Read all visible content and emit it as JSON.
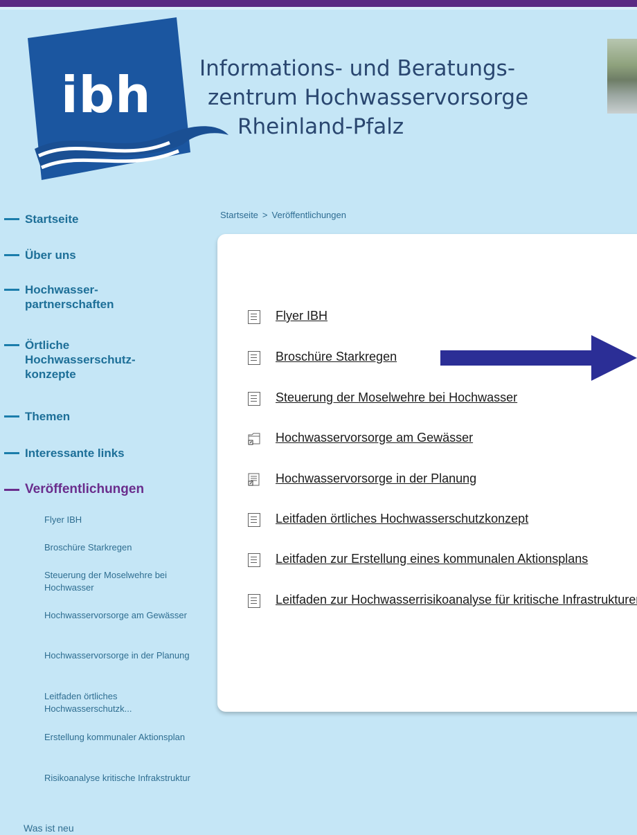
{
  "header": {
    "logo_text": "ibh",
    "org_name_line1": "Informations- und Beratungs-",
    "org_name_line2": "zentrum Hochwasservorsorge",
    "org_name_line3": "Rheinland-Pfalz"
  },
  "breadcrumb": {
    "home": "Startseite",
    "separator": ">",
    "current": "Veröffentlichungen"
  },
  "sidebar": {
    "items": [
      {
        "label": "Startseite"
      },
      {
        "label": "Über uns"
      },
      {
        "label": "Hochwasser-\npartnerschaften"
      },
      {
        "label": "Örtliche\nHochwasserschutz-\nkonzepte"
      },
      {
        "label": "Themen"
      },
      {
        "label": "Interessante links"
      },
      {
        "label": "Veröffentlichungen",
        "active": true
      }
    ],
    "subitems": [
      "Flyer IBH",
      "Broschüre Starkregen",
      "Steuerung der Moselwehre bei Hochwasser",
      "Hochwasservorsorge am Gewässer",
      "Hochwasservorsorge in der Planung",
      "Leitfaden örtliches Hochwasserschutzk...",
      "Erstellung kommunaler Aktionsplan",
      "Risikoanalyse kritische Infrakstruktur"
    ],
    "whats_new": "Was ist neu"
  },
  "documents": [
    {
      "title": "Flyer IBH",
      "icon": "document-icon"
    },
    {
      "title": "Broschüre Starkregen",
      "icon": "document-icon"
    },
    {
      "title": "Steuerung der Moselwehre bei Hochwasser",
      "icon": "document-icon"
    },
    {
      "title": "Hochwasservorsorge am Gewässer",
      "icon": "folder-shortcut-icon"
    },
    {
      "title": "Hochwasservorsorge in der Planung",
      "icon": "document-shortcut-icon"
    },
    {
      "title": "Leitfaden örtliches Hochwasserschutzkonzept",
      "icon": "document-icon"
    },
    {
      "title": "Leitfaden zur Erstellung eines kommunalen Aktionsplans",
      "icon": "document-icon"
    },
    {
      "title": "Leitfaden zur Hochwasserrisikoanalyse für kritische Infrastrukturen",
      "icon": "document-icon"
    }
  ],
  "colors": {
    "background": "#c5e6f6",
    "top_bar": "#5a2a82",
    "nav_text": "#1d6f98",
    "nav_active": "#6a2d8c",
    "logo_blue": "#1b56a0",
    "arrow": "#2b2e96"
  }
}
